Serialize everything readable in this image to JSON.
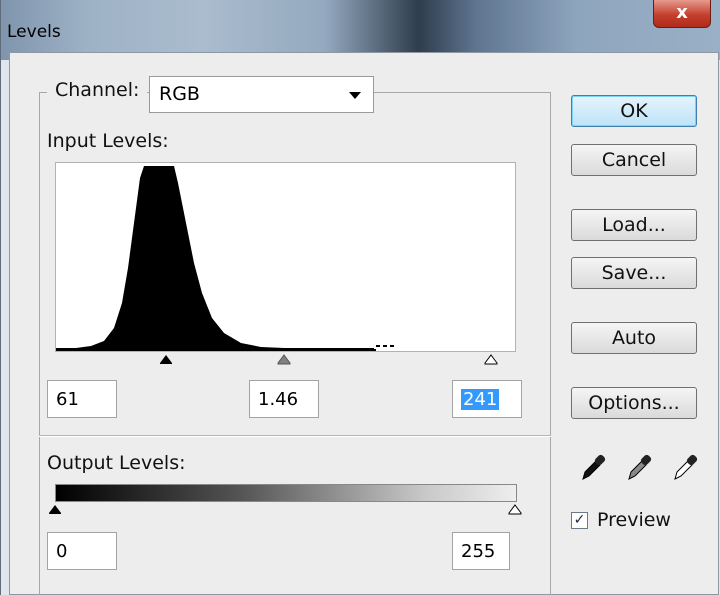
{
  "window": {
    "title": "Levels",
    "close_label": "x"
  },
  "channel": {
    "label": "Channel:",
    "value": "RGB"
  },
  "input_levels": {
    "label": "Input Levels:",
    "black": "61",
    "gamma": "1.46",
    "white": "241"
  },
  "output_levels": {
    "label": "Output Levels:",
    "black": "0",
    "white": "255"
  },
  "buttons": {
    "ok": "OK",
    "cancel": "Cancel",
    "load": "Load...",
    "save": "Save...",
    "auto": "Auto",
    "options": "Options..."
  },
  "eyedroppers": [
    "black-eyedropper-icon",
    "gray-eyedropper-icon",
    "white-eyedropper-icon"
  ],
  "preview": {
    "label": "Preview",
    "checked": true
  },
  "colors": {
    "default_button": "#bde3f8",
    "selection": "#3399ff",
    "close_button": "#c4402e"
  }
}
